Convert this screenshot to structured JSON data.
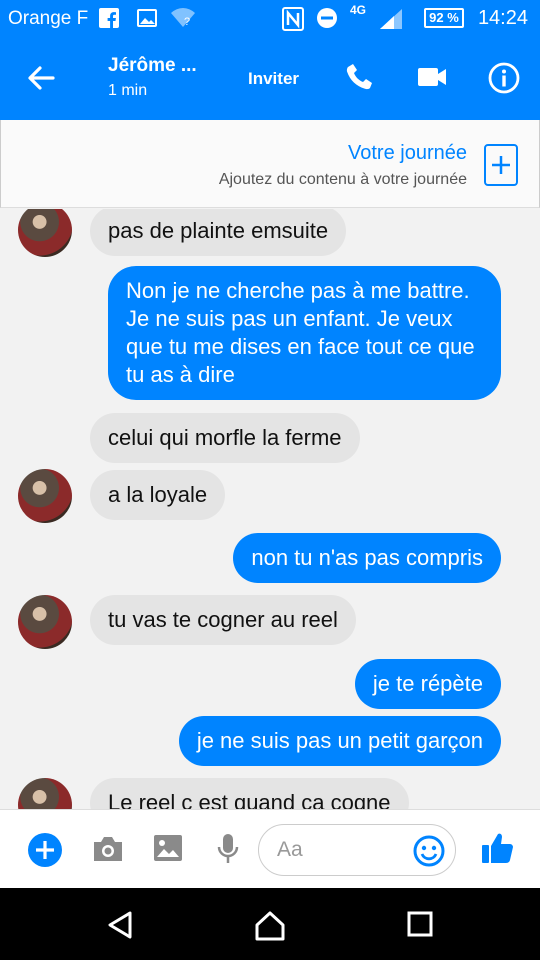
{
  "status_bar": {
    "carrier": "Orange F",
    "network": "4G",
    "battery": "92 %",
    "time": "14:24"
  },
  "header": {
    "contact_name": "Jérôme ...",
    "active_status": "1 min",
    "invite_label": "Inviter"
  },
  "your_day": {
    "title": "Votre journée",
    "subtitle": "Ajoutez du contenu à votre journée"
  },
  "messages": [
    {
      "direction": "in",
      "text": "pas de plainte emsuite"
    },
    {
      "direction": "out",
      "text": "Non je ne cherche pas à me battre. Je ne suis pas un enfant. Je veux que tu me dises en face tout ce que tu as à dire"
    },
    {
      "direction": "in",
      "text": "celui qui morfle la ferme"
    },
    {
      "direction": "in",
      "text": "a la loyale"
    },
    {
      "direction": "out",
      "text": "non tu n'as pas compris"
    },
    {
      "direction": "in",
      "text": "tu vas te cogner au reel"
    },
    {
      "direction": "out",
      "text": "je te répète"
    },
    {
      "direction": "out",
      "text": "je ne suis pas un petit garçon"
    },
    {
      "direction": "in",
      "text": "Le reel c est quand ca cogne"
    }
  ],
  "composer": {
    "placeholder": "Aa"
  },
  "colors": {
    "accent": "#0084ff",
    "incoming_bubble": "#e4e4e4",
    "background": "#f2f2f2"
  }
}
